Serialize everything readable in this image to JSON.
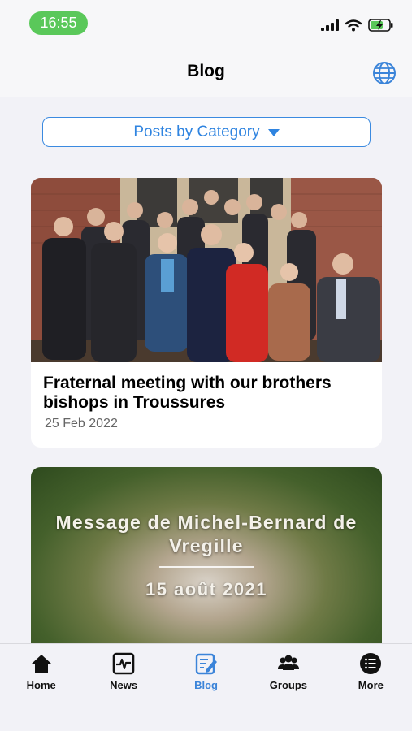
{
  "status_bar": {
    "time": "16:55"
  },
  "header": {
    "title": "Blog"
  },
  "category": {
    "label": "Posts by Category"
  },
  "posts": [
    {
      "title": "Fraternal meeting with our brothers bishops in Troussures",
      "date": "25 Feb 2022"
    },
    {
      "video_title": "Message de Michel-Bernard de Vregille",
      "video_date": "15 août 2021"
    }
  ],
  "tabs": [
    {
      "label": "Home",
      "icon": "home-icon"
    },
    {
      "label": "News",
      "icon": "news-icon"
    },
    {
      "label": "Blog",
      "icon": "blog-icon",
      "active": true
    },
    {
      "label": "Groups",
      "icon": "groups-icon"
    },
    {
      "label": "More",
      "icon": "more-icon"
    }
  ],
  "colors": {
    "accent": "#2f84e0",
    "time_pill": "#5ac85a",
    "background": "#f2f2f7"
  }
}
